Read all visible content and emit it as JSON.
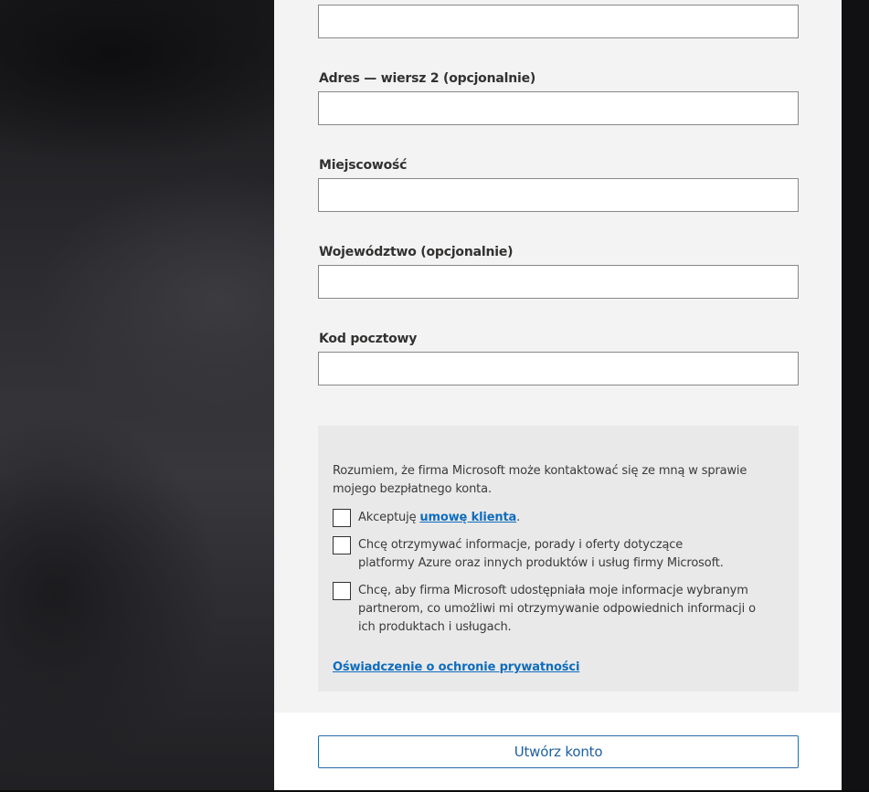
{
  "form": {
    "fields": [
      {
        "label": "",
        "value": "",
        "placeholder": ""
      },
      {
        "label": "Adres — wiersz 2 (opcjonalnie)",
        "value": "",
        "placeholder": ""
      },
      {
        "label": "Miejscowość",
        "value": "",
        "placeholder": ""
      },
      {
        "label": "Województwo (opcjonalnie)",
        "value": "",
        "placeholder": ""
      },
      {
        "label": "Kod pocztowy",
        "value": "",
        "placeholder": ""
      }
    ]
  },
  "consent": {
    "intro": "Rozumiem, że firma Microsoft może kontaktować się ze mną w sprawie mojego bezpłatnego konta.",
    "agreement": {
      "prefix": "Akceptuję ",
      "link": "umowę klienta",
      "suffix": ".",
      "checked": false
    },
    "marketing": {
      "text": "Chcę otrzymywać informacje, porady i oferty dotyczące platformy Azure oraz innych produktów i usług firmy Microsoft.",
      "checked": false
    },
    "partners": {
      "text": "Chcę, aby firma Microsoft udostępniała moje informacje wybranym partnerom, co umożliwi mi otrzymywanie odpowiednich informacji o ich produktach i usługach.",
      "checked": false
    },
    "privacy_link": "Oświadczenie o ochronie prywatności"
  },
  "footer": {
    "create_button": "Utwórz konto"
  },
  "colors": {
    "link": "#0f6cbd",
    "button_border": "#2b6aa8",
    "panel_bg": "#f3f3f4",
    "consent_bg": "#e9e9ea"
  }
}
